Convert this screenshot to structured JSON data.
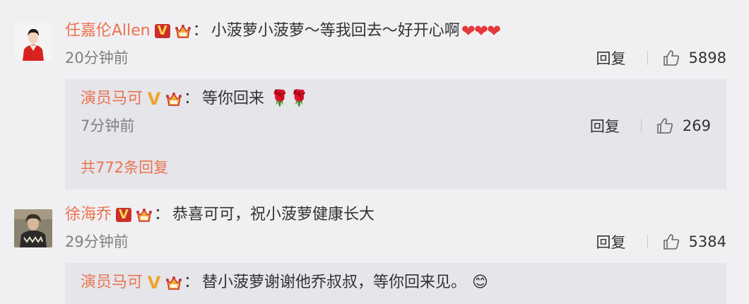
{
  "comments": [
    {
      "user": "任嘉伦Allen",
      "colon": "：",
      "text": "小菠萝小菠萝～等我回去～好开心啊",
      "hearts": "❤❤❤",
      "time": "20分钟前",
      "reply_label": "回复",
      "likes": "5898",
      "replies": [
        {
          "user": "演员马可",
          "colon": "：",
          "text": "等你回来",
          "emoji": "🌹🌹",
          "time": "7分钟前",
          "reply_label": "回复",
          "likes": "269"
        }
      ],
      "more_replies": "共772条回复"
    },
    {
      "user": "徐海乔",
      "colon": "：",
      "text": "恭喜可可，祝小菠萝健康长大",
      "time": "29分钟前",
      "reply_label": "回复",
      "likes": "5384",
      "replies": [
        {
          "user": "演员马可",
          "colon": "：",
          "text": "替小菠萝谢谢他乔叔叔，等你回来见。",
          "emoji": "😊"
        }
      ]
    }
  ],
  "colors": {
    "username": "#eb7350",
    "background": "#f0f0f3",
    "reply_background": "#e5e5ea",
    "timestamp": "#808080"
  }
}
